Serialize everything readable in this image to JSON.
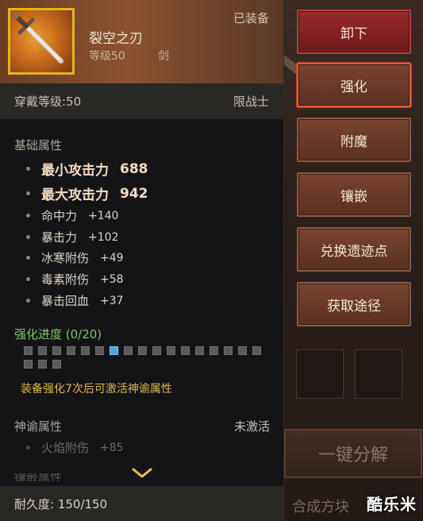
{
  "item": {
    "name": "裂空之刃",
    "level_label": "等级50",
    "type": "剑",
    "equipped_status": "已装备",
    "icon": "sword-icon"
  },
  "requirements": {
    "wear_level": "穿戴等级:50",
    "class_restriction": "限战士"
  },
  "base_attributes": {
    "title": "基础属性",
    "main_stats": [
      {
        "name": "最小攻击力",
        "value": "688"
      },
      {
        "name": "最大攻击力",
        "value": "942"
      }
    ],
    "sub_stats": [
      {
        "name": "命中力",
        "value": "+140"
      },
      {
        "name": "暴击力",
        "value": "+102"
      },
      {
        "name": "冰寒附伤",
        "value": "+49"
      },
      {
        "name": "毒素附伤",
        "value": "+58"
      },
      {
        "name": "暴击回血",
        "value": "+37"
      }
    ]
  },
  "enhancement": {
    "title": "强化进度 (0/20)",
    "total": 20,
    "highlighted_index": 6,
    "note": "装备强化7次后可激活神谕属性"
  },
  "oracle": {
    "title": "神谕属性",
    "status": "未激活",
    "stat": {
      "name": "火焰附伤",
      "value": "+85"
    }
  },
  "durability": "耐久度: 150/150",
  "actions": [
    "卸下",
    "强化",
    "附魔",
    "镶嵌",
    "兑换遗迹点",
    "获取途径"
  ],
  "background": {
    "bottom_button": "一键分解",
    "bottom_text": "合成方块"
  },
  "watermark": "酷乐米",
  "colors": {
    "enhance_title": "#7ec868",
    "enhance_note": "#e0b848",
    "icon_border": "#e6b31e",
    "active_pip": "#4aa8e0"
  }
}
